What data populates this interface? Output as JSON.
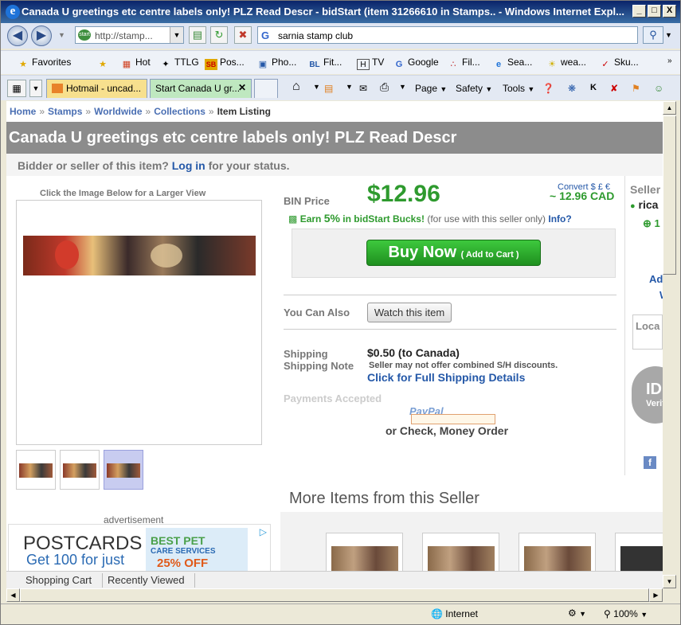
{
  "window": {
    "title": "Canada U greetings etc centre labels only! PLZ Read Descr - bidStart (item 31266610 in Stamps.. - Windows Internet Expl...",
    "btn_min": "_",
    "btn_max": "□",
    "btn_close": "X"
  },
  "addressbar": {
    "url": "http://stamp...",
    "search_value": "sarnia stamp club"
  },
  "favorites": {
    "label": "Favorites",
    "items": [
      "Hot",
      "TTLG",
      "Pos...",
      "Pho...",
      "Fit...",
      "TV",
      "Google",
      "Fil...",
      "Sea...",
      "wea...",
      "Sku..."
    ]
  },
  "tabs": [
    {
      "label": "Hotmail - uncad..."
    },
    {
      "label": "Start Canada U gr..."
    }
  ],
  "commandbar": {
    "page": "Page",
    "safety": "Safety",
    "tools": "Tools"
  },
  "breadcrumb": [
    "Home",
    "Stamps",
    "Worldwide",
    "Collections",
    "Item Listing"
  ],
  "item": {
    "title": "Canada U greetings etc centre labels only! PLZ Read Descr",
    "bidder_prefix": "Bidder or seller of this item?",
    "login": "Log in",
    "bidder_suffix": "for your status.",
    "image_caption": "Click the Image Below for a Larger View"
  },
  "buy": {
    "bin_label": "BIN Price",
    "price": "$12.96",
    "convert_link": "Convert $ £ €",
    "cad_price": "~ 12.96 CAD",
    "earn": "Earn",
    "bucks_pct": "5%",
    "bucks_text": "in bidStart Bucks!",
    "bucks_note": "(for use with this seller only)",
    "info": "Info?",
    "buy_now": "Buy Now",
    "add_to_cart": "( Add to Cart )",
    "also_label": "You Can Also",
    "watch": "Watch this item"
  },
  "shipping": {
    "label": "Shipping",
    "note_label": "Shipping Note",
    "value": "$0.50 (to Canada)",
    "note": "Seller may not offer combined S/H discounts.",
    "details_link": "Click for Full Shipping Details",
    "payments_label": "Payments Accepted",
    "paypal": "PayPal",
    "other_payments": "or Check, Money Order"
  },
  "seller": {
    "label": "Seller",
    "name": "rica",
    "rating": "1",
    "ad": "Ad",
    "w": "W",
    "location": "Loca",
    "badge": "ID",
    "badge_sub": "Verif"
  },
  "advert": {
    "label": "advertisement",
    "line1": "POSTCARDS",
    "line2": "Get 100 for just",
    "pet1": "BEST PET",
    "pet2": "CARE SERVICES",
    "pet3": "25% OFF"
  },
  "more_items": {
    "title": "More Items from this Seller"
  },
  "linkbar": {
    "cart": "Shopping Cart",
    "recent": "Recently Viewed"
  },
  "status": {
    "zone": "Internet",
    "zoom": "100%"
  }
}
